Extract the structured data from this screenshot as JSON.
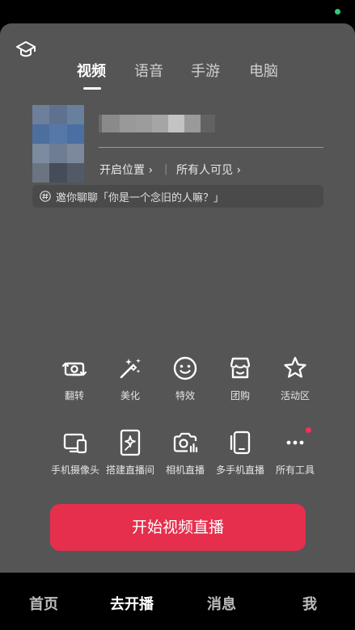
{
  "tabs": [
    {
      "label": "视频",
      "active": true
    },
    {
      "label": "语音",
      "active": false
    },
    {
      "label": "手游",
      "active": false
    },
    {
      "label": "电脑",
      "active": false
    }
  ],
  "stream": {
    "location_label": "开启位置",
    "visibility_label": "所有人可见",
    "separator": "|",
    "invite_text": "邀你聊聊「你是一个念旧的人嘛？」"
  },
  "tools_row1": [
    {
      "label": "翻转",
      "icon": "flip-camera-icon"
    },
    {
      "label": "美化",
      "icon": "magic-wand-icon"
    },
    {
      "label": "特效",
      "icon": "smiley-face-icon"
    },
    {
      "label": "团购",
      "icon": "shop-icon"
    },
    {
      "label": "活动区",
      "icon": "star-icon"
    }
  ],
  "tools_row2": [
    {
      "label": "手机摄像头",
      "icon": "phone-camera-icon"
    },
    {
      "label": "搭建直播间",
      "icon": "sparkle-card-icon"
    },
    {
      "label": "相机直播",
      "icon": "camera-live-icon"
    },
    {
      "label": "多手机直播",
      "icon": "multi-phone-icon"
    },
    {
      "label": "所有工具",
      "icon": "more-dots-icon",
      "has_badge": true
    }
  ],
  "start_button": "开始视频直播",
  "bottom_nav": [
    {
      "label": "首页",
      "active": false
    },
    {
      "label": "去开播",
      "active": true
    },
    {
      "label": "消息",
      "active": false
    },
    {
      "label": "我",
      "active": false
    }
  ],
  "colors": {
    "panel": "#555555",
    "accent": "#e62f4d",
    "status_dot": "#2ecc71",
    "badge": "#fe2c55"
  }
}
